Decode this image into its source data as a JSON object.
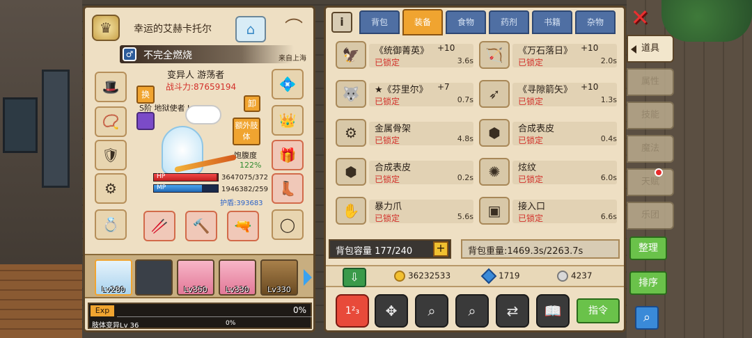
{
  "character": {
    "title": "幸运的艾赫卡托尔",
    "status": "不完全燃烧",
    "origin": "来自上海",
    "name": "变异人 游荡者",
    "power": "战斗力:87659194",
    "rank": "S阶 地狱使者 Lv 100",
    "swap_label": "换",
    "remove_label": "卸",
    "extra_limbs_label": "额外肢体",
    "satiety_label": "饱腹度",
    "satiety_value": "122%",
    "hp_label": "HP",
    "hp_value": "3647075/372",
    "hp_fraction": 0.98,
    "mp_label": "MP",
    "mp_value": "1946382/259",
    "mp_fraction": 0.75,
    "shield": "护盾:393683"
  },
  "team": [
    {
      "level": "Lv280",
      "style": "blue"
    },
    {
      "level": "",
      "style": "empty"
    },
    {
      "level": "Lv350",
      "style": "pink"
    },
    {
      "level": "Lv330",
      "style": "pink"
    },
    {
      "level": "Lv330",
      "style": "brown"
    }
  ],
  "exp": {
    "tag": "Exp",
    "percent": "0%",
    "skill_label": "肢体变异Lv 36",
    "skill_percent": "0%"
  },
  "inventory": {
    "tabs": [
      "背包",
      "装备",
      "食物",
      "药剂",
      "书籍",
      "杂物"
    ],
    "active_tab": 1,
    "items": [
      {
        "name": "《统御菁英》",
        "plus": "+10",
        "lock": "已锁定",
        "time": "3.6s",
        "icon": "🦅"
      },
      {
        "name": "《万石落日》",
        "plus": "+10",
        "lock": "已锁定",
        "time": "2.0s",
        "icon": "🏹"
      },
      {
        "name": "★《芬里尔》",
        "plus": "+7",
        "lock": "已锁定",
        "time": "0.7s",
        "icon": "🐺"
      },
      {
        "name": "《寻隙箭矢》",
        "plus": "+10",
        "lock": "已锁定",
        "time": "1.3s",
        "icon": "➶"
      },
      {
        "name": "金属骨架",
        "plus": "",
        "lock": "已锁定",
        "time": "4.8s",
        "icon": "⚙"
      },
      {
        "name": "合成表皮",
        "plus": "",
        "lock": "已锁定",
        "time": "0.4s",
        "icon": "⬢"
      },
      {
        "name": "合成表皮",
        "plus": "",
        "lock": "已锁定",
        "time": "0.2s",
        "icon": "⬢"
      },
      {
        "name": "炫纹",
        "plus": "",
        "lock": "已锁定",
        "time": "6.0s",
        "icon": "✺"
      },
      {
        "name": "暴力爪",
        "plus": "",
        "lock": "已锁定",
        "time": "5.6s",
        "icon": "✋"
      },
      {
        "name": "接入口",
        "plus": "",
        "lock": "已锁定",
        "time": "6.6s",
        "icon": "▣"
      }
    ],
    "capacity": "背包容量 177/240",
    "weight": "背包重量:1469.3s/2263.7s",
    "gold": "36232533",
    "gems": "1719",
    "silver": "4237",
    "command_label": "指令"
  },
  "sidebar": {
    "tabs": [
      "道具",
      "属性",
      "技能",
      "魔法",
      "天赋",
      "乐团"
    ],
    "active_tab": 0,
    "organize_label": "整理",
    "sort_label": "排序"
  },
  "colors": {
    "accent": "#f0a430",
    "panel": "#eedfc3",
    "lock_red": "#d3302a",
    "green": "#6ac24a"
  }
}
